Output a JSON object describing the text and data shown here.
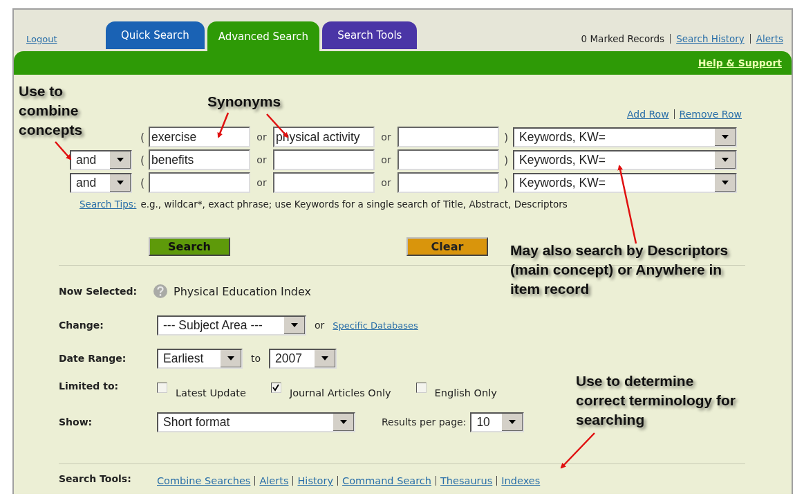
{
  "header": {
    "logout": "Logout",
    "tabs": [
      {
        "label": "Quick Search",
        "selected": false,
        "color": "#1a62b4"
      },
      {
        "label": "Advanced Search",
        "selected": true,
        "color": "#2e9a06"
      },
      {
        "label": "Search Tools",
        "selected": false,
        "color": "#4a35a6"
      }
    ],
    "marked_records": "0 Marked Records",
    "links": [
      "Search History",
      "Alerts"
    ],
    "help_link": "Help & Support"
  },
  "query": {
    "row_links": [
      "Add Row",
      "Remove Row"
    ],
    "rows": [
      {
        "open": "(",
        "terms": [
          {
            "kind": "term",
            "value": "exercise"
          },
          {
            "kind": "term",
            "value": "physical activity"
          },
          {
            "kind": "term"
          }
        ],
        "joiners": [
          "or",
          "or"
        ],
        "close": ")",
        "field": "Keywords, KW="
      },
      {
        "operator": "and",
        "open": "(",
        "terms": [
          {
            "kind": "term",
            "value": "benefits"
          },
          {
            "kind": "term"
          },
          {
            "kind": "term"
          }
        ],
        "joiners": [
          "or",
          "or"
        ],
        "close": ")",
        "field": "Keywords, KW="
      },
      {
        "operator": "and",
        "open": "(",
        "terms": [
          {
            "kind": "term"
          },
          {
            "kind": "term"
          },
          {
            "kind": "term"
          }
        ],
        "joiners": [
          "or",
          "or"
        ],
        "close": ")",
        "field": "Keywords, KW="
      }
    ],
    "tips_link": "Search Tips:",
    "tips_text": "e.g., wildcar*, exact phrase; use Keywords for a single search of Title, Abstract, Descriptors"
  },
  "buttons": [
    {
      "label": "Search",
      "kind": "search"
    },
    {
      "label": "Clear",
      "kind": "clear"
    }
  ],
  "options": {
    "now_selected": {
      "label": "Now Selected:",
      "value": "Physical Education Index"
    },
    "change": {
      "label": "Change:",
      "select": "--- Subject Area ---",
      "joiner": "or",
      "link": "Specific Databases"
    },
    "date_range": {
      "label": "Date Range:",
      "from": "Earliest",
      "joiner": "to",
      "to": "2007"
    },
    "limits": {
      "label": "Limited to:",
      "items": [
        {
          "label": "Latest Update",
          "checked": false
        },
        {
          "label": "Journal Articles Only",
          "checked": true
        },
        {
          "label": "English Only",
          "checked": false
        }
      ]
    },
    "show": {
      "label": "Show:",
      "select": "Short format",
      "per_page_label": "Results per page:",
      "per_page": "10"
    }
  },
  "search_tools": {
    "label": "Search Tools:",
    "links": [
      "Combine Searches",
      "Alerts",
      "History",
      "Command Search",
      "Thesaurus",
      "Indexes"
    ]
  },
  "annotations": [
    {
      "text": "Use to combine concepts"
    },
    {
      "text": "Synonyms"
    },
    {
      "text": "May also search by Descriptors (main concept) or Anywhere in item record"
    },
    {
      "text": "Use to determine correct terminology for searching"
    }
  ]
}
